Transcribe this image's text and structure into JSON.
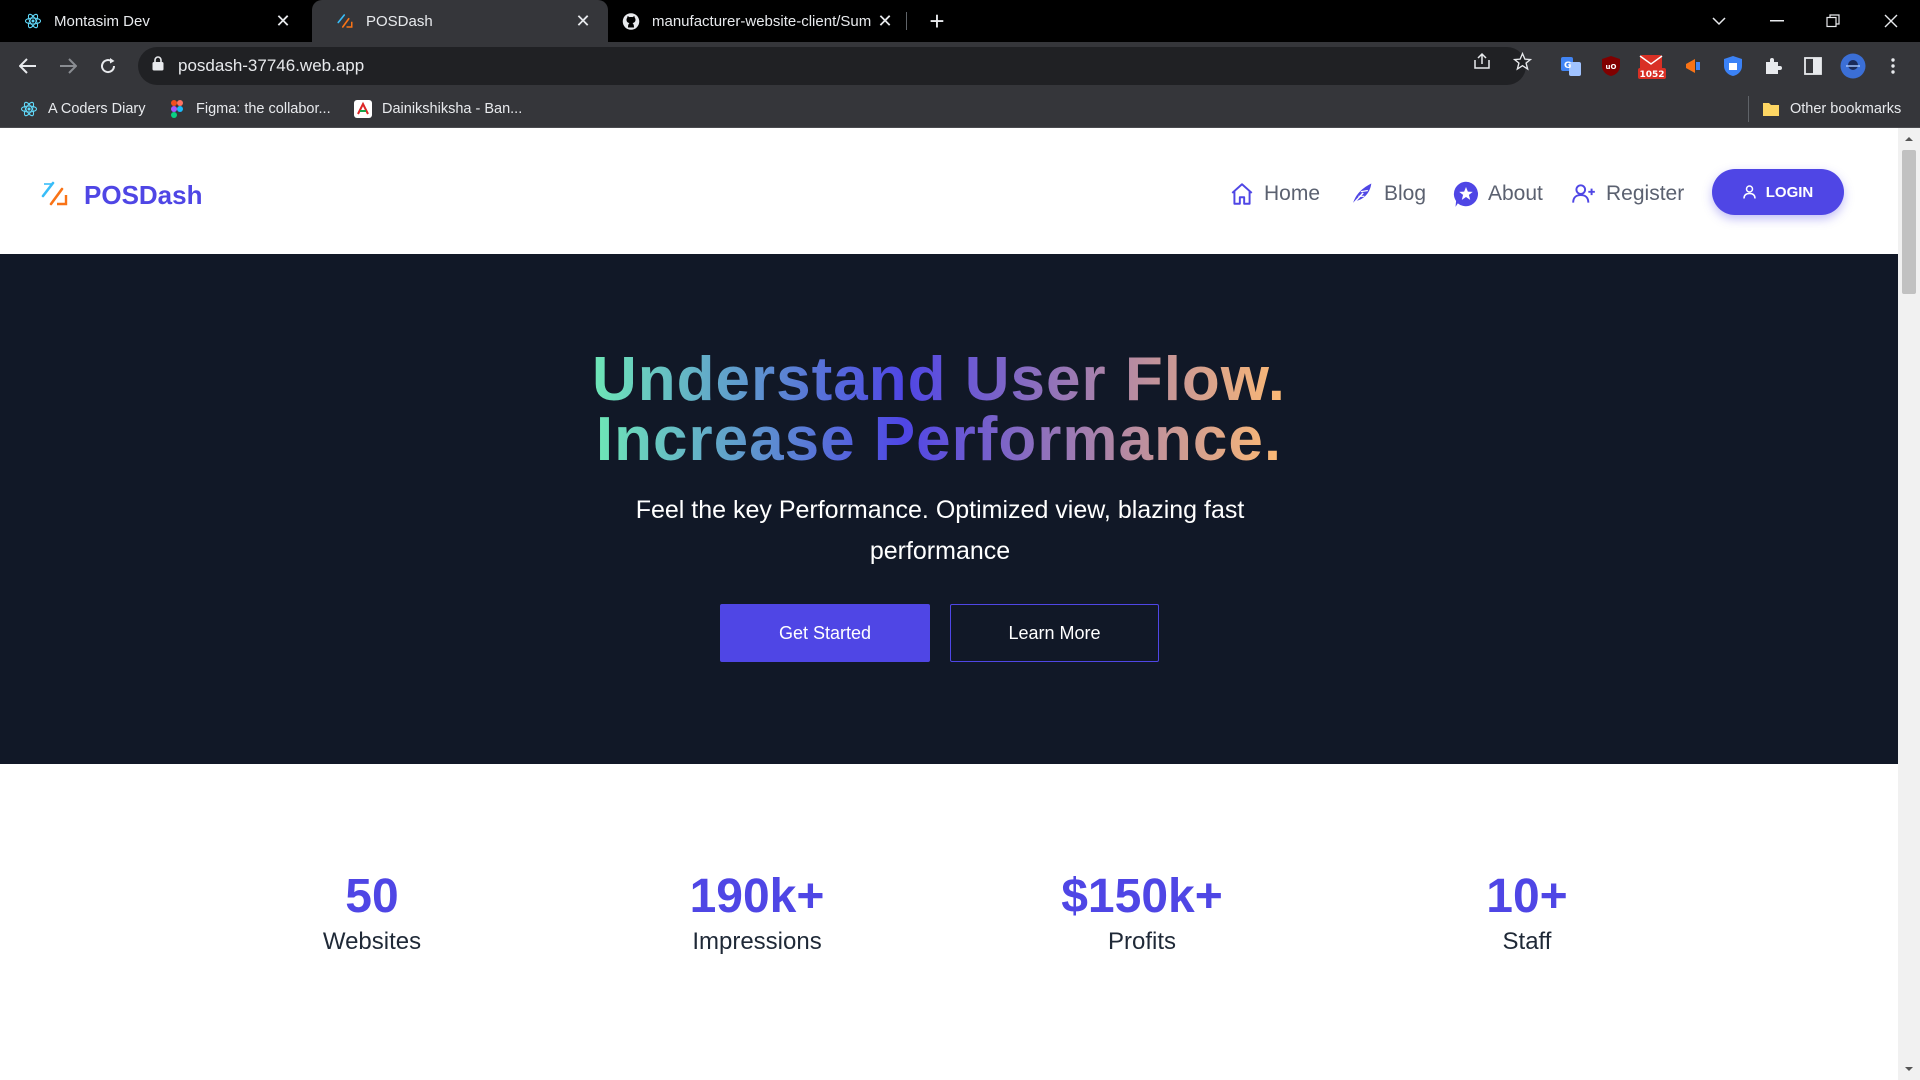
{
  "browser": {
    "tabs": [
      {
        "title": "Montasim Dev",
        "favicon": "react-icon",
        "active": false
      },
      {
        "title": "POSDash",
        "favicon": "posdash-logo-icon",
        "active": true
      },
      {
        "title": "manufacturer-website-client/Sum",
        "favicon": "github-icon",
        "active": false
      }
    ],
    "url": "posdash-37746.web.app",
    "extension_badge": "1052",
    "bookmarks": [
      {
        "label": "A Coders Diary",
        "icon": "react-icon"
      },
      {
        "label": "Figma: the collabor...",
        "icon": "figma-icon"
      },
      {
        "label": "Dainikshiksha - Ban...",
        "icon": "dainikshiksha-icon"
      }
    ],
    "other_bookmarks": "Other bookmarks"
  },
  "site": {
    "brand": "POSDash",
    "nav": [
      {
        "label": "Home",
        "icon": "home-icon"
      },
      {
        "label": "Blog",
        "icon": "blog-feather-icon"
      },
      {
        "label": "About",
        "icon": "star-badge-icon"
      },
      {
        "label": "Register",
        "icon": "user-plus-icon"
      }
    ],
    "login_label": "LOGIN",
    "accent": "#4f46e5"
  },
  "hero": {
    "title_line1": "Understand User Flow.",
    "title_line2": "Increase Performance.",
    "subtitle": "Feel the key Performance. Optimized view, blazing fast performance",
    "primary_button": "Get Started",
    "secondary_button": "Learn More",
    "background": "#111827"
  },
  "stats": [
    {
      "value": "50",
      "label": "Websites"
    },
    {
      "value": "190k+",
      "label": "Impressions"
    },
    {
      "value": "$150k+",
      "label": "Profits"
    },
    {
      "value": "10+",
      "label": "Staff"
    }
  ]
}
